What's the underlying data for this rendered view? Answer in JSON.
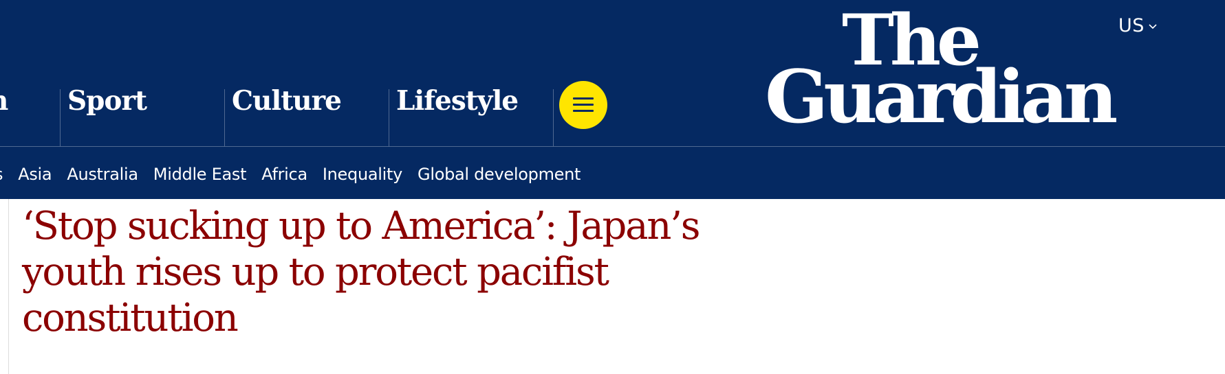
{
  "header": {
    "background_color": "#052962",
    "edition": {
      "label": "US",
      "icon": "chevron-down-icon"
    },
    "logo": {
      "line1": "The",
      "line2": "Guardian"
    },
    "pillars": [
      {
        "label": "n"
      },
      {
        "label": "Sport"
      },
      {
        "label": "Culture"
      },
      {
        "label": "Lifestyle"
      }
    ],
    "menu": {
      "icon": "hamburger-menu-icon",
      "color": "#ffe500"
    },
    "subnav": [
      {
        "label": "s"
      },
      {
        "label": "Asia"
      },
      {
        "label": "Australia"
      },
      {
        "label": "Middle East"
      },
      {
        "label": "Africa"
      },
      {
        "label": "Inequality"
      },
      {
        "label": "Global development"
      }
    ]
  },
  "article": {
    "headline": "‘Stop sucking up to America’: Japan’s youth rises up to protect pacifist constitution",
    "headline_color": "#8b0000"
  }
}
